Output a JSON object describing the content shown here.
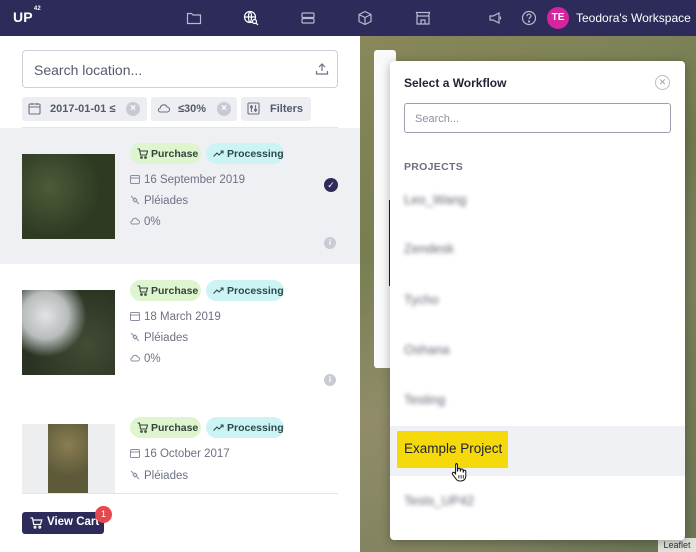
{
  "topbar": {
    "logo": "UP",
    "logo_sup": "42",
    "nav_icons": [
      "folder-icon",
      "globe-search-icon",
      "storage-icon",
      "cube-icon",
      "store-icon"
    ],
    "workspace": "Teodora's Workspace",
    "avatar_initials": "TE",
    "avatar_color": "#d6249f"
  },
  "sidebar": {
    "search_placeholder": "Search location...",
    "filters": {
      "date": "2017-01-01 ≤",
      "cloud": "≤30%",
      "filters_label": "Filters"
    },
    "results": [
      {
        "purchase": "Purchase",
        "status": "Processing",
        "date": "16 September 2019",
        "sensor": "Pléiades",
        "cloud": "0%",
        "selected": true
      },
      {
        "purchase": "Purchase",
        "status": "Processing",
        "date": "18 March 2019",
        "sensor": "Pléiades",
        "cloud": "0%",
        "selected": false
      },
      {
        "purchase": "Purchase",
        "status": "Processing",
        "date": "16 October 2017",
        "sensor": "Pléiades",
        "selected": false
      }
    ],
    "cart": {
      "label": "View Cart",
      "count": "1"
    }
  },
  "modal": {
    "title": "Select a Workflow",
    "search_placeholder": "Search...",
    "section_label": "PROJECTS",
    "projects": [
      "Leo_Wang",
      "Zendesk",
      "Tycho",
      "Oshana",
      "Testing",
      "Example Project",
      "Tests_UP42"
    ],
    "highlighted_project": "Example Project",
    "highlight_color": "#f5d90a"
  },
  "map": {
    "attribution": "Leaflet"
  }
}
